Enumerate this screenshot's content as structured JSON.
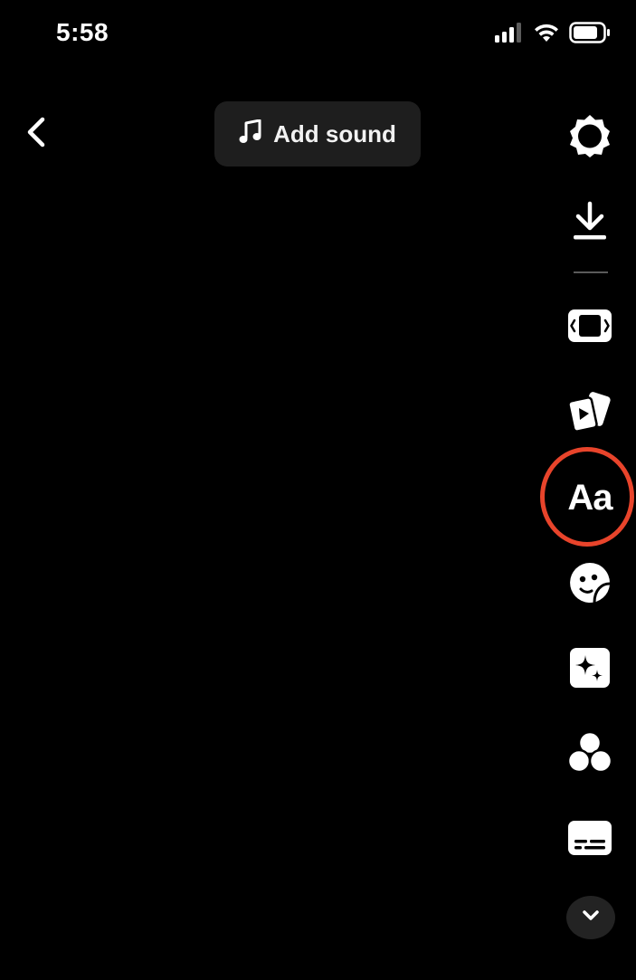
{
  "status_bar": {
    "time": "5:58",
    "signal_icon": "cellular-signal-icon",
    "wifi_icon": "wifi-icon",
    "battery_icon": "battery-icon"
  },
  "header": {
    "back_icon": "chevron-left-icon",
    "add_sound": {
      "icon": "music-note-icon",
      "label": "Add sound"
    }
  },
  "toolbar": {
    "items": [
      {
        "name": "settings",
        "icon": "gear-icon"
      },
      {
        "name": "download",
        "icon": "download-icon"
      },
      {
        "name": "adjust-clips",
        "icon": "adjust-clips-icon"
      },
      {
        "name": "templates",
        "icon": "cards-play-icon"
      },
      {
        "name": "text",
        "icon": "text-icon",
        "label": "Aa",
        "highlighted": true
      },
      {
        "name": "stickers",
        "icon": "sticker-icon"
      },
      {
        "name": "effects",
        "icon": "sparkle-icon"
      },
      {
        "name": "filters",
        "icon": "filters-icon"
      },
      {
        "name": "captions",
        "icon": "captions-icon"
      },
      {
        "name": "more",
        "icon": "chevron-down-icon"
      }
    ]
  },
  "colors": {
    "background": "#000000",
    "icon": "#ffffff",
    "pill_background": "#1e1e1e",
    "highlight": "#e8442b"
  }
}
